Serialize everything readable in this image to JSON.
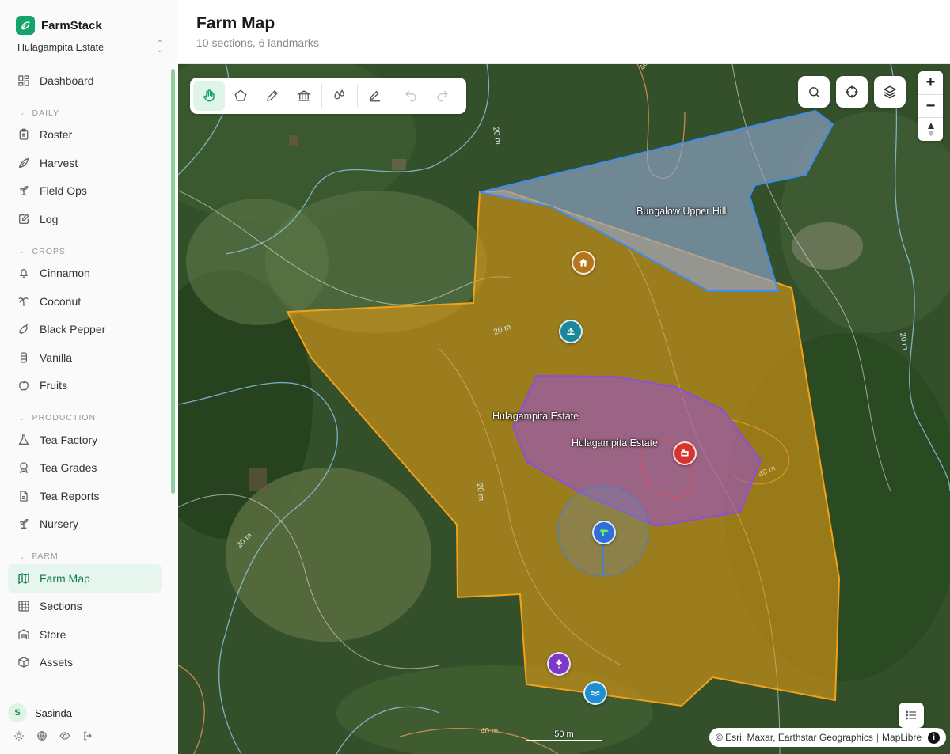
{
  "app": {
    "name": "FarmStack",
    "estate": "Hulagampita Estate"
  },
  "sidebar": {
    "top": [
      {
        "label": "Dashboard",
        "icon": "dashboard-icon"
      }
    ],
    "daily": {
      "title": "DAILY",
      "items": [
        {
          "label": "Roster",
          "icon": "clipboard-icon"
        },
        {
          "label": "Harvest",
          "icon": "leaf-icon"
        },
        {
          "label": "Field Ops",
          "icon": "sprout-icon"
        },
        {
          "label": "Log",
          "icon": "notebook-icon"
        }
      ]
    },
    "crops": {
      "title": "CROPS",
      "items": [
        {
          "label": "Cinnamon",
          "icon": "bell-icon"
        },
        {
          "label": "Coconut",
          "icon": "palm-icon"
        },
        {
          "label": "Black Pepper",
          "icon": "pepper-icon"
        },
        {
          "label": "Vanilla",
          "icon": "vanilla-icon"
        },
        {
          "label": "Fruits",
          "icon": "apple-icon"
        }
      ]
    },
    "production": {
      "title": "PRODUCTION",
      "items": [
        {
          "label": "Tea Factory",
          "icon": "flask-icon"
        },
        {
          "label": "Tea Grades",
          "icon": "award-icon"
        },
        {
          "label": "Tea Reports",
          "icon": "file-icon"
        },
        {
          "label": "Nursery",
          "icon": "sprout-icon"
        }
      ]
    },
    "farm": {
      "title": "FARM",
      "items": [
        {
          "label": "Farm Map",
          "icon": "map-icon"
        },
        {
          "label": "Sections",
          "icon": "grid-icon"
        },
        {
          "label": "Store",
          "icon": "warehouse-icon"
        },
        {
          "label": "Assets",
          "icon": "package-icon"
        }
      ]
    },
    "user": {
      "initial": "S",
      "name": "Sasinda"
    }
  },
  "header": {
    "title": "Farm Map",
    "subtitle": "10 sections, 6 landmarks"
  },
  "map": {
    "labels": {
      "bungalow": "Bungalow Upper Hill",
      "estate_a": "Hulagampita Estate",
      "estate_b": "Hulagampita Estate"
    },
    "contour_label": "20 m",
    "contour_label_2": "40 m",
    "scale": "50 m",
    "attribution": {
      "sources": "© Esri, Maxar, Earthstar Geographics",
      "sep": "|",
      "library": "MapLibre",
      "info": "i"
    },
    "zoom": {
      "in": "+",
      "out": "−"
    },
    "colors": {
      "estate": "#e59a10",
      "bungalow": "#4a8df0",
      "section": "#8a4fe0",
      "accent": "#16a36b"
    }
  }
}
